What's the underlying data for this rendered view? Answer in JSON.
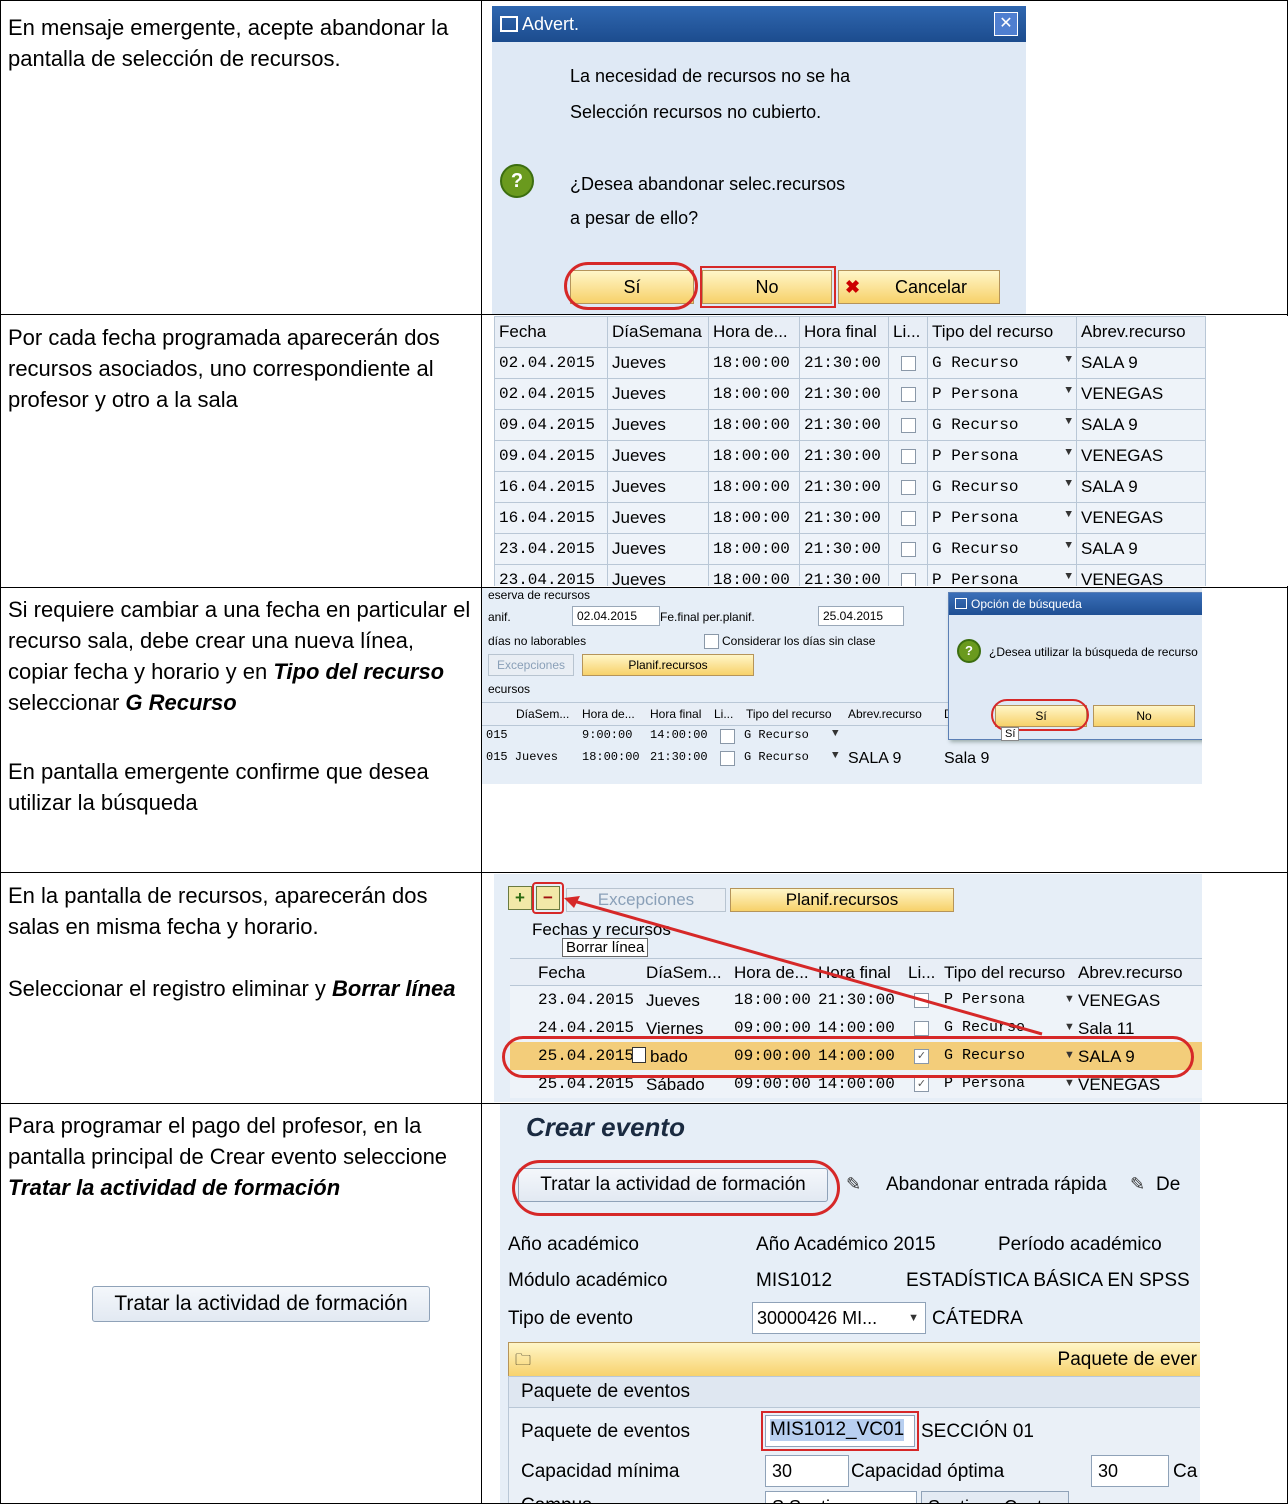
{
  "rows": [
    {
      "text": [
        "En mensaje emergente, acepte abandonar la pantalla de selección de recursos."
      ]
    },
    {
      "text": [
        "Por cada fecha programada aparecerán dos recursos asociados, uno correspondiente al profesor y otro a la sala"
      ]
    },
    {
      "text_a": "Si requiere cambiar a una fecha en particular el recurso sala, debe crear una nueva línea, copiar fecha y horario y en ",
      "bold_a": "Tipo del recurso",
      "text_b": " seleccionar ",
      "bold_b": "G Recurso",
      "text_c": "En pantalla emergente confirme que desea utilizar la búsqueda"
    },
    {
      "text_a": "En la pantalla de recursos, aparecerán dos salas en misma fecha y horario.",
      "text_b": "Seleccionar el registro eliminar y ",
      "bold_b": "Borrar línea"
    },
    {
      "text_a": "Para programar el pago del profesor, en la pantalla principal de Crear evento seleccione ",
      "bold_a": "Tratar la actividad de formación",
      "button": "Tratar la actividad de formación"
    }
  ],
  "popup1": {
    "title": "Advert.",
    "line1": "La necesidad de recursos no se ha",
    "line2": "Selección recursos no cubierto.",
    "q1": "¿Desea abandonar selec.recursos",
    "q2": "a pesar de ello?",
    "yes": "Sí",
    "no": "No",
    "cancel": "Cancelar"
  },
  "grid1": {
    "headers": [
      "Fecha",
      "DíaSemana",
      "Hora de...",
      "Hora final",
      "Li...",
      "Tipo del recurso",
      "Abrev.recurso"
    ],
    "rows": [
      [
        "02.04.2015",
        "Jueves",
        "18:00:00",
        "21:30:00",
        "G Recurso",
        "SALA 9"
      ],
      [
        "02.04.2015",
        "Jueves",
        "18:00:00",
        "21:30:00",
        "P Persona",
        "VENEGAS"
      ],
      [
        "09.04.2015",
        "Jueves",
        "18:00:00",
        "21:30:00",
        "G Recurso",
        "SALA 9"
      ],
      [
        "09.04.2015",
        "Jueves",
        "18:00:00",
        "21:30:00",
        "P Persona",
        "VENEGAS"
      ],
      [
        "16.04.2015",
        "Jueves",
        "18:00:00",
        "21:30:00",
        "G Recurso",
        "SALA 9"
      ],
      [
        "16.04.2015",
        "Jueves",
        "18:00:00",
        "21:30:00",
        "P Persona",
        "VENEGAS"
      ],
      [
        "23.04.2015",
        "Jueves",
        "18:00:00",
        "21:30:00",
        "G Recurso",
        "SALA 9"
      ],
      [
        "23.04.2015",
        "Jueves",
        "18:00:00",
        "21:30:00",
        "P Persona",
        "VENEGAS"
      ]
    ]
  },
  "shot3": {
    "section": "eserva de recursos",
    "planif": "anif.",
    "date1": "02.04.2015",
    "fefinal": "Fe.final per.planif.",
    "date2": "25.04.2015",
    "nolab": "días no laborables",
    "sinclase": "Considerar los días sin clase",
    "excep": "Excepciones",
    "planrec": "Planif.recursos",
    "recursos": "ecursos",
    "headers": [
      "DíaSem...",
      "Hora de...",
      "Hora final",
      "Li...",
      "Tipo del recurso",
      "Abrev.recurso",
      "D"
    ],
    "r1": [
      "015",
      "9:00:00",
      "14:00:00",
      "G Recurso"
    ],
    "r2": [
      "015 Jueves",
      "18:00:00",
      "21:30:00",
      "G Recurso",
      "SALA 9",
      "Sala 9"
    ],
    "popup_title": "Opción de búsqueda",
    "popup_q": "¿Desea utilizar la búsqueda de recurso",
    "yes": "Sí",
    "no": "No",
    "tooltip": "Sí"
  },
  "shot4": {
    "excep": "Excepciones",
    "planrec": "Planif.recursos",
    "section": "Fechas y recursos",
    "tooltip": "Borrar línea",
    "headers": [
      "Fecha",
      "DíaSem...",
      "Hora de...",
      "Hora final",
      "Li...",
      "Tipo del recurso",
      "Abrev.recurso"
    ],
    "rows": [
      [
        "23.04.2015",
        "Jueves",
        "18:00:00",
        "21:30:00",
        "P Persona",
        "VENEGAS"
      ],
      [
        "24.04.2015",
        "Viernes",
        "09:00:00",
        "14:00:00",
        "G Recurso",
        "Sala 11"
      ],
      [
        "25.04.2015",
        "bado",
        "09:00:00",
        "14:00:00",
        "G Recurso",
        "SALA 9"
      ],
      [
        "25.04.2015",
        "Sábado",
        "09:00:00",
        "14:00:00",
        "P Persona",
        "VENEGAS"
      ]
    ]
  },
  "shot5": {
    "title": "Crear evento",
    "btn": "Tratar la actividad de formación",
    "abandon": "Abandonar entrada rápida",
    "de": "De",
    "anio_l": "Año académico",
    "anio_v": "Año Académico 2015",
    "periodo": "Período académico",
    "modulo_l": "Módulo académico",
    "modulo_v": "MIS1012",
    "modulo_t": "ESTADÍSTICA BÁSICA EN SPSS",
    "tipo_l": "Tipo de evento",
    "tipo_v": "30000426 MI...",
    "tipo_t": "CÁTEDRA",
    "paq_bar": "Paquete de ever",
    "paq_sec": "Paquete de eventos",
    "paq_l": "Paquete de eventos",
    "paq_v": "MIS1012_VC01",
    "paq_t": "SECCIÓN 01",
    "capmin_l": "Capacidad mínima",
    "capmin_v": "30",
    "capopt_l": "Capacidad óptima",
    "capopt_v": "30",
    "cap_trunc": "Ca",
    "campus_l": "Campus",
    "campus_v": "S Santiago",
    "campus_t": "Santiago Centro"
  }
}
